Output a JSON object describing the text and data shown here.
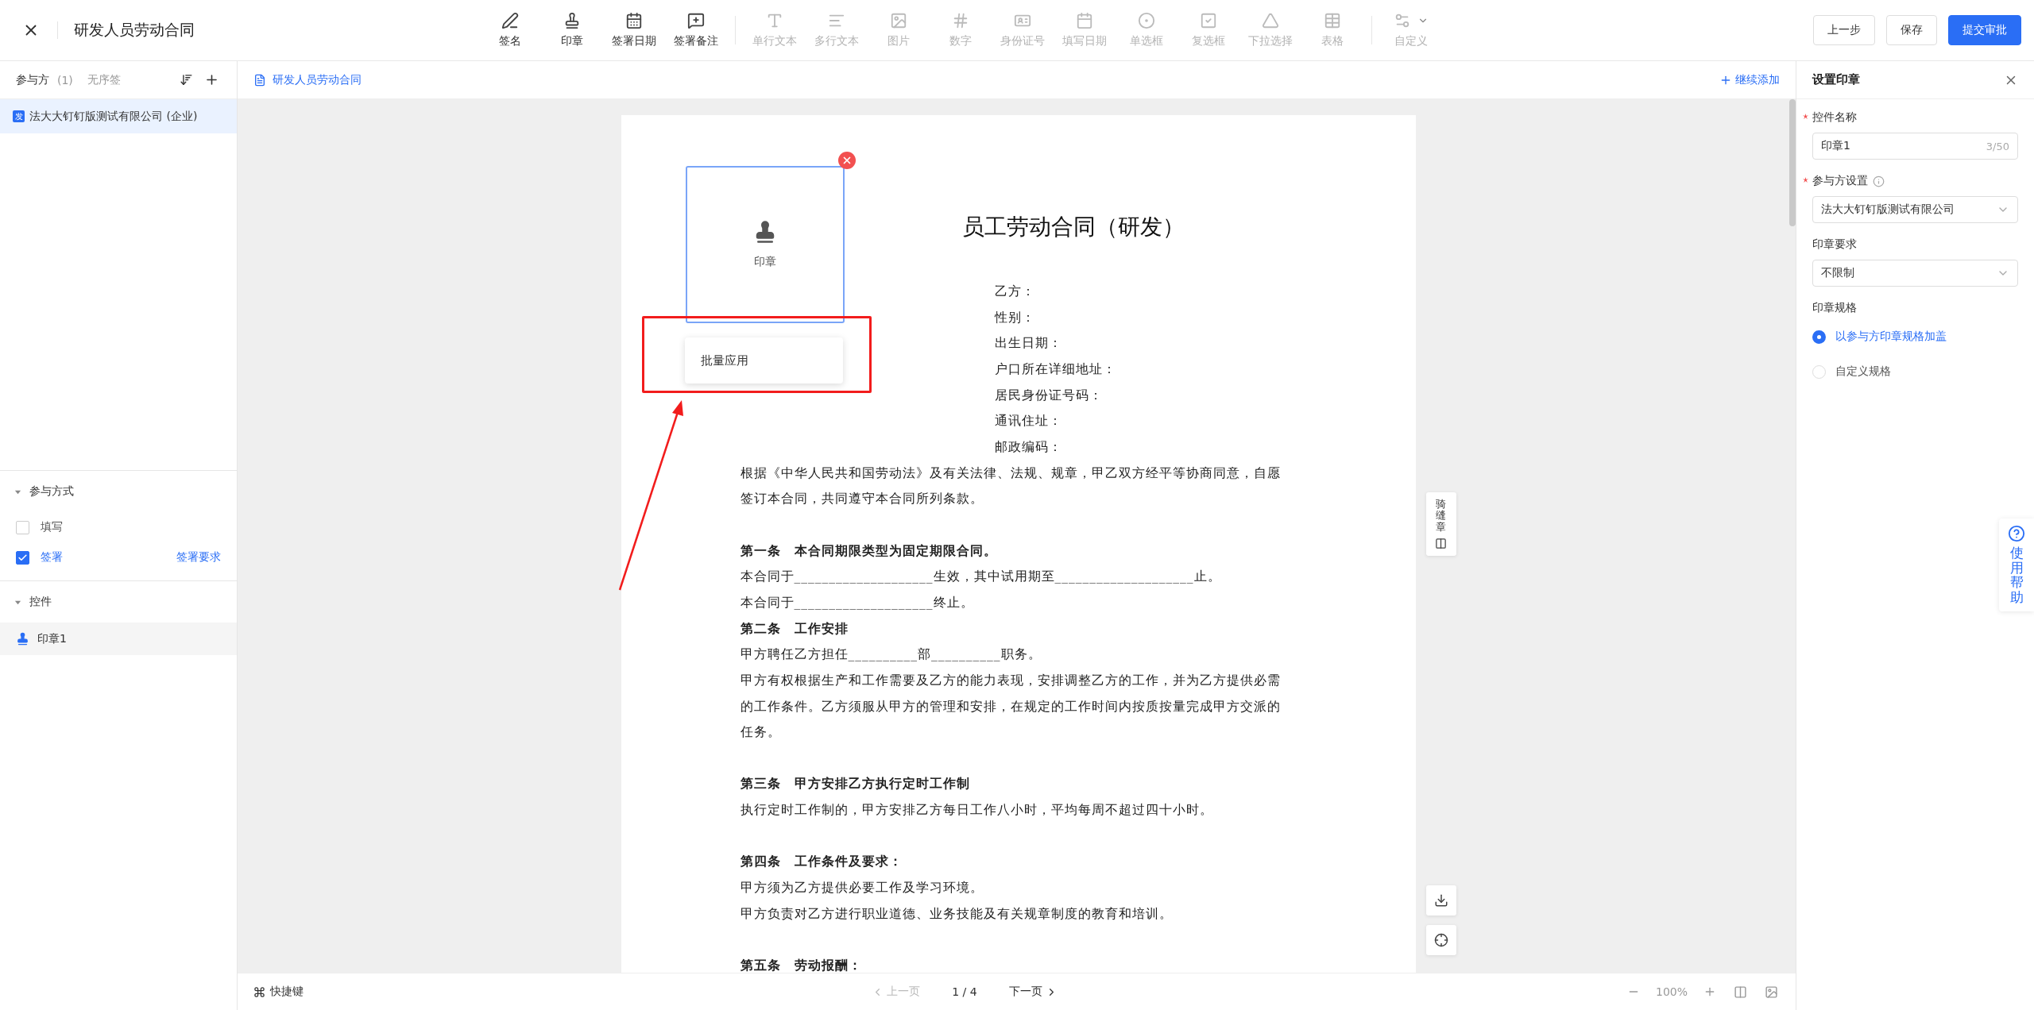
{
  "top_bar": {
    "title": "研发人员劳动合同",
    "tool_groups": [
      [
        {
          "label": "签名",
          "disabled": false
        },
        {
          "label": "印章",
          "disabled": false
        },
        {
          "label": "签署日期",
          "disabled": false
        },
        {
          "label": "签署备注",
          "disabled": false
        }
      ],
      [
        {
          "label": "单行文本",
          "disabled": true
        },
        {
          "label": "多行文本",
          "disabled": true
        },
        {
          "label": "图片",
          "disabled": true
        },
        {
          "label": "数字",
          "disabled": true
        },
        {
          "label": "身份证号",
          "disabled": true
        },
        {
          "label": "填写日期",
          "disabled": true
        },
        {
          "label": "单选框",
          "disabled": true
        },
        {
          "label": "复选框",
          "disabled": true
        },
        {
          "label": "下拉选择",
          "disabled": true
        },
        {
          "label": "表格",
          "disabled": true
        }
      ],
      [
        {
          "label": "自定义",
          "disabled": true
        }
      ]
    ],
    "buttons": [
      {
        "label": "上一步",
        "kind": "default"
      },
      {
        "label": "保存",
        "kind": "default"
      },
      {
        "label": "提交审批",
        "kind": "primary"
      }
    ]
  },
  "sidebar": {
    "title": "参与方",
    "count": "(1)",
    "mode": "无序签",
    "participants": [
      {
        "badge": "发",
        "name": "法大大钉钉版测试有限公司 (企业)",
        "selected": true
      }
    ],
    "participation": {
      "title": "参与方式",
      "expanded": true,
      "options": [
        {
          "label": "填写",
          "checked": false
        },
        {
          "label": "签署",
          "checked": true,
          "link": "签署要求"
        }
      ]
    },
    "controls": {
      "title": "控件",
      "expanded": true,
      "items": [
        {
          "label": "印章1",
          "selected": true
        }
      ]
    }
  },
  "document": {
    "tab": "研发人员劳动合同",
    "add_more": "继续添加",
    "title": "员工劳动合同（研发）",
    "stamp_field": {
      "label": "印章",
      "popup": "批量应用"
    },
    "sections": [
      [
        {
          "kind": "info",
          "text": "乙方："
        },
        {
          "kind": "info",
          "text": "性别："
        },
        {
          "kind": "info",
          "text": "出生日期："
        },
        {
          "kind": "info",
          "text": "户口所在详细地址："
        },
        {
          "kind": "info",
          "text": "居民身份证号码："
        },
        {
          "kind": "info",
          "text": "通讯住址："
        },
        {
          "kind": "info",
          "text": "邮政编码："
        },
        {
          "kind": "para",
          "text": "根据《中华人民共和国劳动法》及有关法律、法规、规章，甲乙双方经平等协商同意，自愿签订本合同，共同遵守本合同所列条款。"
        }
      ],
      [
        {
          "kind": "heading",
          "text": "第一条　本合同期限类型为固定期限合同。"
        },
        {
          "kind": "text",
          "text": "本合同于____________________生效，其中试用期至____________________止。"
        },
        {
          "kind": "text",
          "text": "本合同于____________________终止。"
        },
        {
          "kind": "heading",
          "text": "第二条　工作安排"
        },
        {
          "kind": "text",
          "text": "甲方聘任乙方担任__________部__________职务。"
        },
        {
          "kind": "para",
          "text": "甲方有权根据生产和工作需要及乙方的能力表现，安排调整乙方的工作，并为乙方提供必需的工作条件。乙方须服从甲方的管理和安排，在规定的工作时间内按质按量完成甲方交派的任务。"
        }
      ],
      [
        {
          "kind": "heading",
          "text": "第三条　甲方安排乙方执行定时工作制"
        },
        {
          "kind": "text",
          "text": "执行定时工作制的，甲方安排乙方每日工作八小时，平均每周不超过四十小时。"
        }
      ],
      [
        {
          "kind": "heading",
          "text": "第四条　工作条件及要求："
        },
        {
          "kind": "text",
          "text": "甲方须为乙方提供必要工作及学习环境。"
        },
        {
          "kind": "text",
          "text": "甲方负责对乙方进行职业道德、业务技能及有关规章制度的教育和培训。"
        }
      ],
      [
        {
          "kind": "heading",
          "text": "第五条　劳动报酬："
        }
      ]
    ],
    "seam_stamp": "骑缝章"
  },
  "bottom_bar": {
    "shortcuts": "快捷键",
    "prev": {
      "label": "上一页",
      "disabled": true
    },
    "page": "1 / 4",
    "next": {
      "label": "下一页",
      "disabled": false
    },
    "zoom": "100%"
  },
  "panel": {
    "title": "设置印章",
    "fields": [
      {
        "kind": "input",
        "label": "控件名称",
        "required": true,
        "info": false,
        "value": "印章1",
        "counter": "3/50"
      },
      {
        "kind": "select",
        "label": "参与方设置",
        "required": true,
        "info": true,
        "value": "法大大钉钉版测试有限公司"
      },
      {
        "kind": "select",
        "label": "印章要求",
        "required": false,
        "info": false,
        "value": "不限制"
      },
      {
        "kind": "radio",
        "label": "印章规格",
        "required": false,
        "info": false,
        "options": [
          {
            "label": "以参与方印章规格加盖",
            "selected": true
          },
          {
            "label": "自定义规格",
            "selected": false
          }
        ]
      }
    ]
  },
  "help": "使用帮助"
}
